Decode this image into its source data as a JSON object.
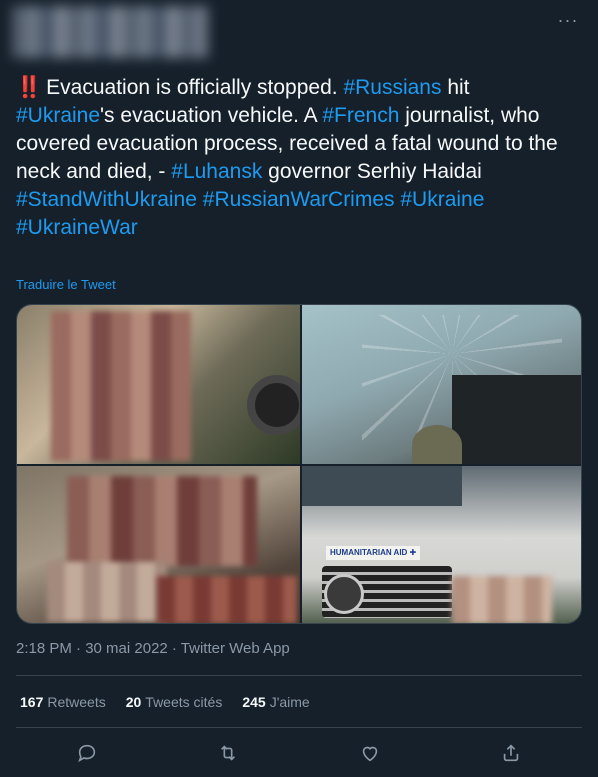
{
  "tweet": {
    "more_label": "···",
    "text_segments": [
      {
        "text": "‼️",
        "type": "emoji"
      },
      {
        "text": "Evacuation is officially stopped. ",
        "type": "plain"
      },
      {
        "text": "#Russians",
        "type": "tag"
      },
      {
        "text": " hit ",
        "type": "plain"
      },
      {
        "text": "#Ukraine",
        "type": "tag"
      },
      {
        "text": "'s evacuation vehicle. A ",
        "type": "plain"
      },
      {
        "text": "#French",
        "type": "tag"
      },
      {
        "text": " journalist, who covered evacuation process, received a fatal wound to the neck and died, - ",
        "type": "plain"
      },
      {
        "text": "#Luhansk",
        "type": "tag"
      },
      {
        "text": " governor Serhiy Haidai",
        "type": "plain"
      },
      {
        "text": "#StandWithUkraine",
        "type": "tag"
      },
      {
        "text": " ",
        "type": "plain"
      },
      {
        "text": "#RussianWarCrimes",
        "type": "tag"
      },
      {
        "text": " ",
        "type": "plain"
      },
      {
        "text": "#Ukraine",
        "type": "tag"
      },
      {
        "text": " ",
        "type": "plain"
      },
      {
        "text": "#UkraineWar",
        "type": "tag"
      }
    ],
    "translate_label": "Traduire le Tweet",
    "media_badge_text": "HUMANITARIAN AID ✚",
    "timestamp": "2:18 PM · 30 mai 2022 · Twitter Web App",
    "stats": {
      "retweets_count": "167",
      "retweets_label": "Retweets",
      "quotes_count": "20",
      "quotes_label": "Tweets cités",
      "likes_count": "245",
      "likes_label": "J'aime"
    },
    "actions": [
      "reply-icon",
      "retweet-icon",
      "like-icon",
      "share-icon"
    ],
    "colors": {
      "background": "#15202b",
      "text": "#f7f9f9",
      "link": "#1d9bf0",
      "muted": "#8b98a5",
      "border": "#38444d"
    }
  }
}
